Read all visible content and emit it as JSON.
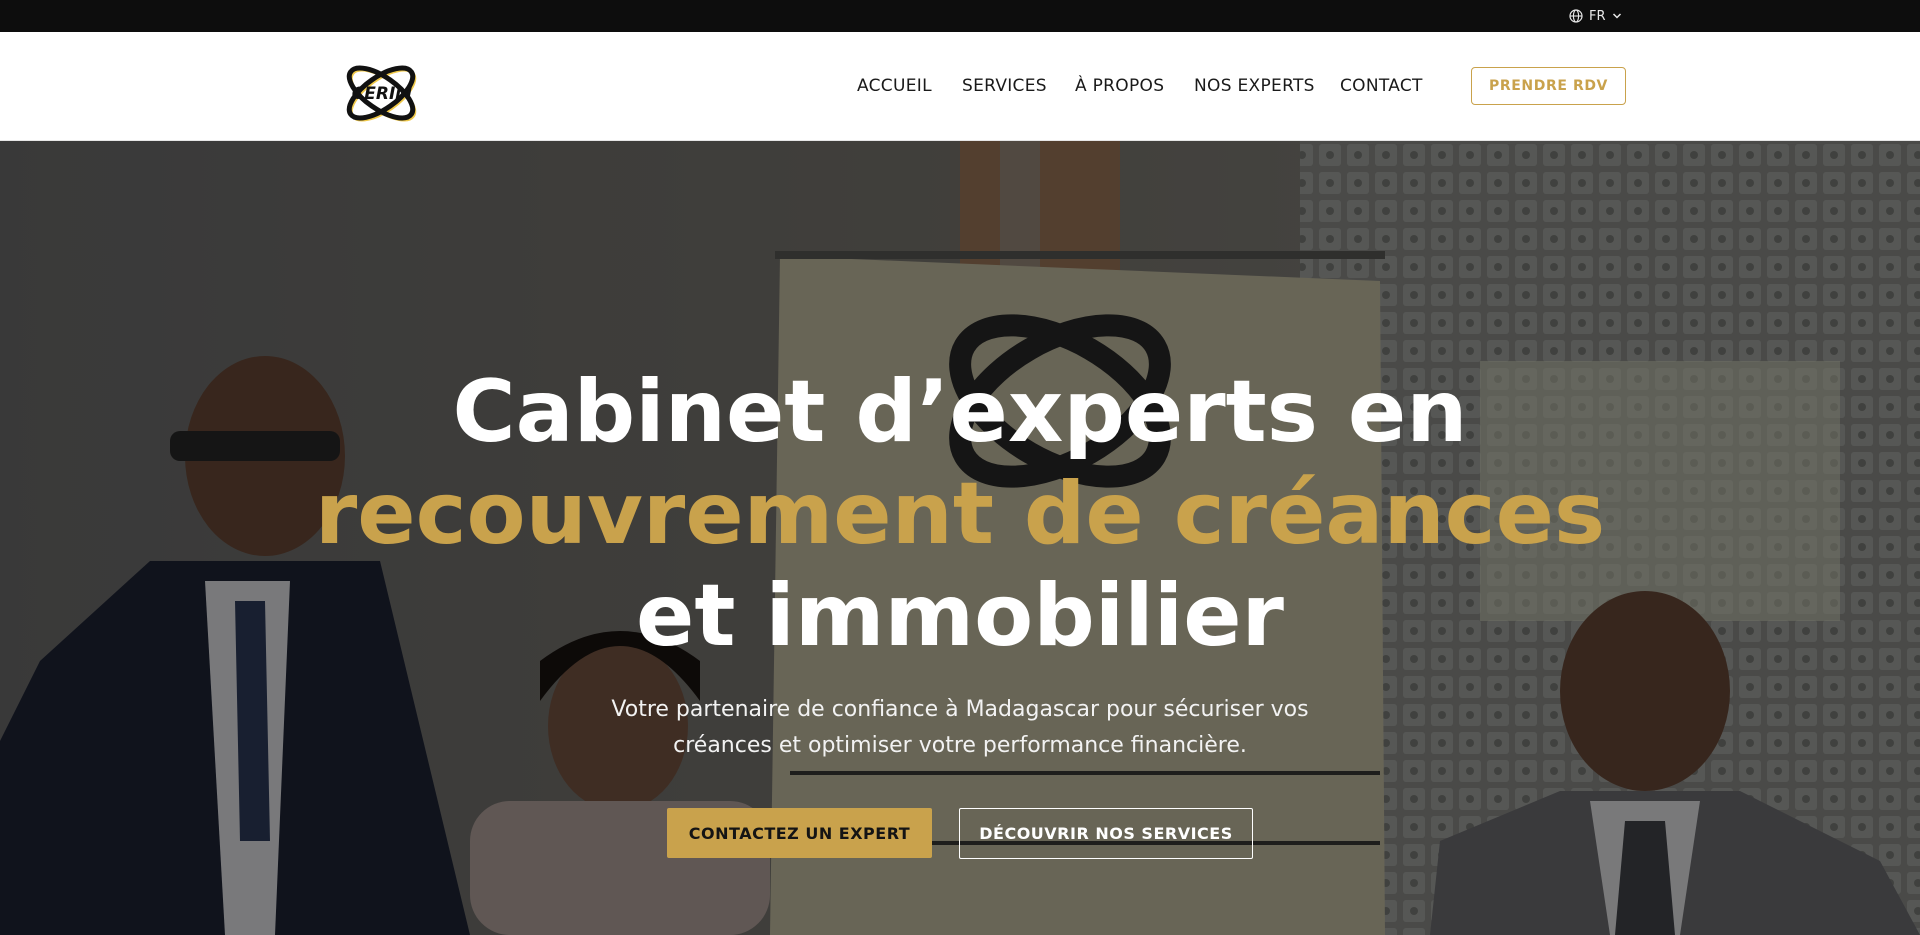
{
  "topbar": {
    "language": "FR",
    "globe_icon": "globe-icon",
    "chevron_icon": "chevron-down-icon"
  },
  "header": {
    "logo_text": "CERIM",
    "nav": [
      {
        "label": "ACCUEIL"
      },
      {
        "label": "SERVICES"
      },
      {
        "label": "À PROPOS"
      },
      {
        "label": "NOS EXPERTS"
      },
      {
        "label": "CONTACT"
      }
    ],
    "cta_label": "PRENDRE RDV"
  },
  "hero": {
    "title_line1": "Cabinet d’experts en",
    "title_line2": "recouvrement de créances",
    "title_line3": "et immobilier",
    "subtitle": "Votre partenaire de confiance à Madagascar pour sécuriser vos créances et optimiser votre performance financière.",
    "primary_button": "CONTACTEZ UN EXPERT",
    "secondary_button": "DÉCOUVRIR NOS SERVICES"
  },
  "colors": {
    "accent_gold": "#c9a24c",
    "topbar_bg": "#0d0d0d",
    "header_bg": "#ffffff",
    "text_dark": "#1a1a1a"
  }
}
